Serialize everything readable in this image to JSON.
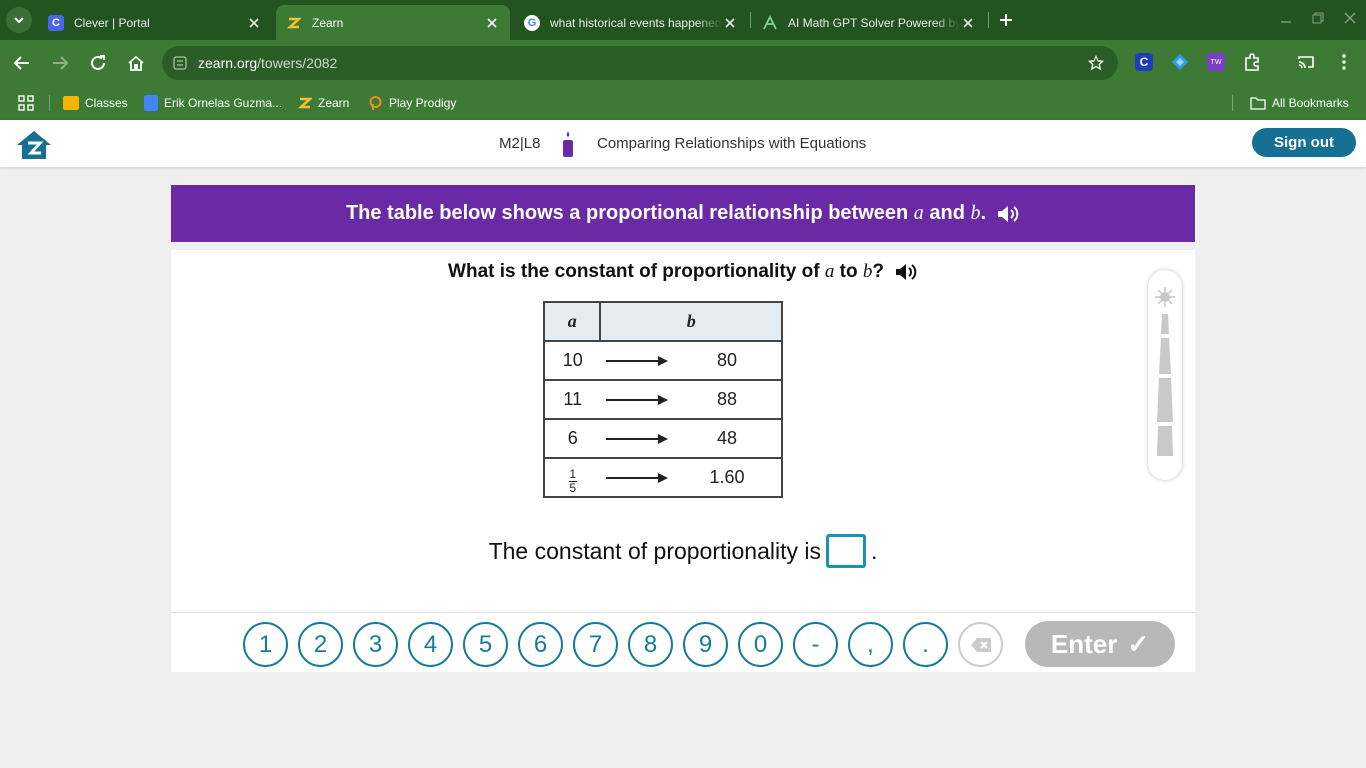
{
  "browser": {
    "tabs": [
      {
        "title": "Clever | Portal",
        "active": false
      },
      {
        "title": "Zearn",
        "active": true
      },
      {
        "title": "what historical events happened",
        "active": false
      },
      {
        "title": "AI Math GPT Solver Powered by",
        "active": false
      }
    ],
    "url_domain": "zearn.org",
    "url_path": "/towers/2082",
    "bookmarks": [
      "Classes",
      "Erik Ornelas Guzma...",
      "Zearn",
      "Play Prodigy"
    ],
    "all_bookmarks": "All Bookmarks"
  },
  "header": {
    "lesson_code": "M2|L8",
    "lesson_title": "Comparing Relationships with Equations",
    "signout_label": "Sign out"
  },
  "problem": {
    "banner": {
      "prefix": "The table below shows a proportional relationship between",
      "var_a": "a",
      "conj": "and",
      "var_b": "b",
      "suffix": "."
    },
    "question": {
      "prefix": "What is the constant of proportionality of",
      "var_a": "a",
      "mid": "to",
      "var_b": "b",
      "suffix": "?"
    },
    "table": {
      "headers": [
        "a",
        "b"
      ],
      "rows": [
        {
          "a": "10",
          "b": "80"
        },
        {
          "a": "11",
          "b": "88"
        },
        {
          "a": "6",
          "b": "48"
        },
        {
          "a_num": "1",
          "a_den": "5",
          "b": "1.60"
        }
      ]
    },
    "answer_prefix": "The constant of proportionality is",
    "answer_suffix": "."
  },
  "keypad": {
    "keys": [
      "1",
      "2",
      "3",
      "4",
      "5",
      "6",
      "7",
      "8",
      "9",
      "0",
      "-",
      ",",
      "."
    ],
    "enter_label": "Enter",
    "enter_check": "✓"
  },
  "colors": {
    "tabbar": "#21541e",
    "toolbar": "#3d7a36",
    "banner": "#6a2aa6",
    "accent": "#167b98",
    "signout": "#157093"
  }
}
